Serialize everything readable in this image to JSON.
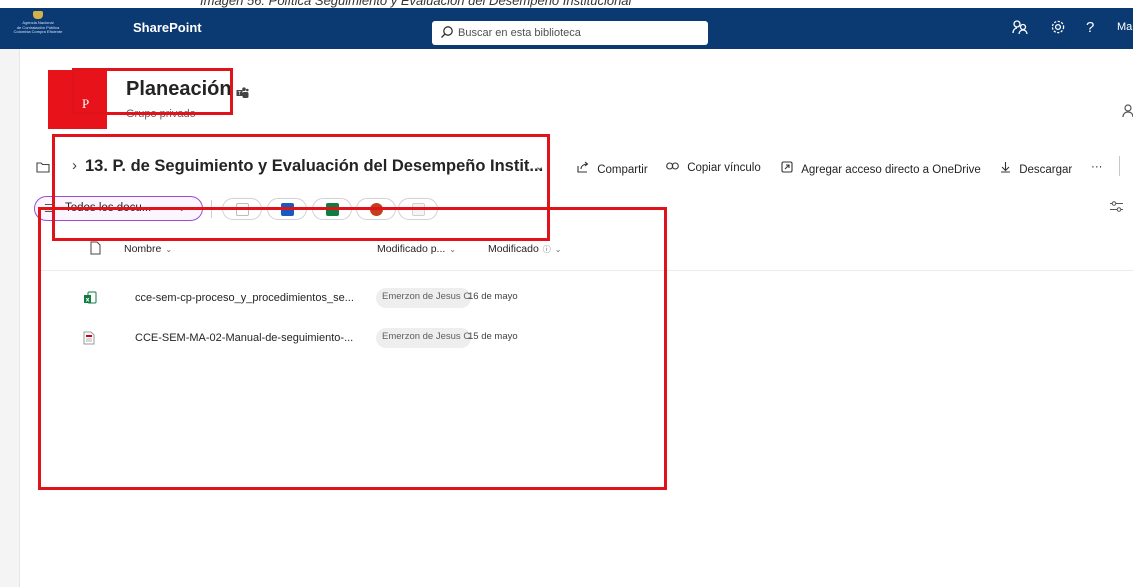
{
  "caption": "Imagen 56. Política Seguimiento y Evaluación del Desempeño Institucional",
  "suitebar": {
    "org_logo_lines": [
      "Agencia Nacional",
      "de Contratación Pública",
      "Colombia Compra Eficiente"
    ],
    "app_name": "SharePoint",
    "search_placeholder": "Buscar en esta biblioteca",
    "user_initials": "Ma",
    "help_glyph": "?"
  },
  "site": {
    "logo_letter": "P",
    "title": "Planeación",
    "subtitle": "Grupo privado"
  },
  "commandbar": {
    "breadcrumb": "13. P. de Seguimiento y Evaluación del Desempeño Instit...",
    "share": "Compartir",
    "copy_link": "Copiar vínculo",
    "add_shortcut": "Agregar acceso directo a OneDrive",
    "download": "Descargar",
    "more": "···"
  },
  "view": {
    "label": "Todos los docu..."
  },
  "columns": {
    "name": "Nombre",
    "modified_by": "Modificado p...",
    "modified": "Modificado"
  },
  "files": [
    {
      "name": "cce-sem-cp-proceso_y_procedimientos_se...",
      "type": "excel",
      "modified_by": "Emerzon de Jesus Car",
      "modified": "16 de mayo"
    },
    {
      "name": "CCE-SEM-MA-02-Manual-de-seguimiento-...",
      "type": "pdf",
      "modified_by": "Emerzon de Jesus Car",
      "modified": "15 de mayo"
    }
  ],
  "colors": {
    "suitebar": "#0b3a72",
    "site_logo": "#e8131a",
    "annotation": "#e0131a",
    "view_pill_border": "#9b4dd1"
  },
  "icons": [
    "search-icon",
    "share-icon",
    "link-icon",
    "shortcut-icon",
    "download-icon",
    "gear-icon",
    "help-icon",
    "folder-icon",
    "teams-icon",
    "file-icon",
    "excel-icon",
    "pdf-icon",
    "filter-icon"
  ]
}
